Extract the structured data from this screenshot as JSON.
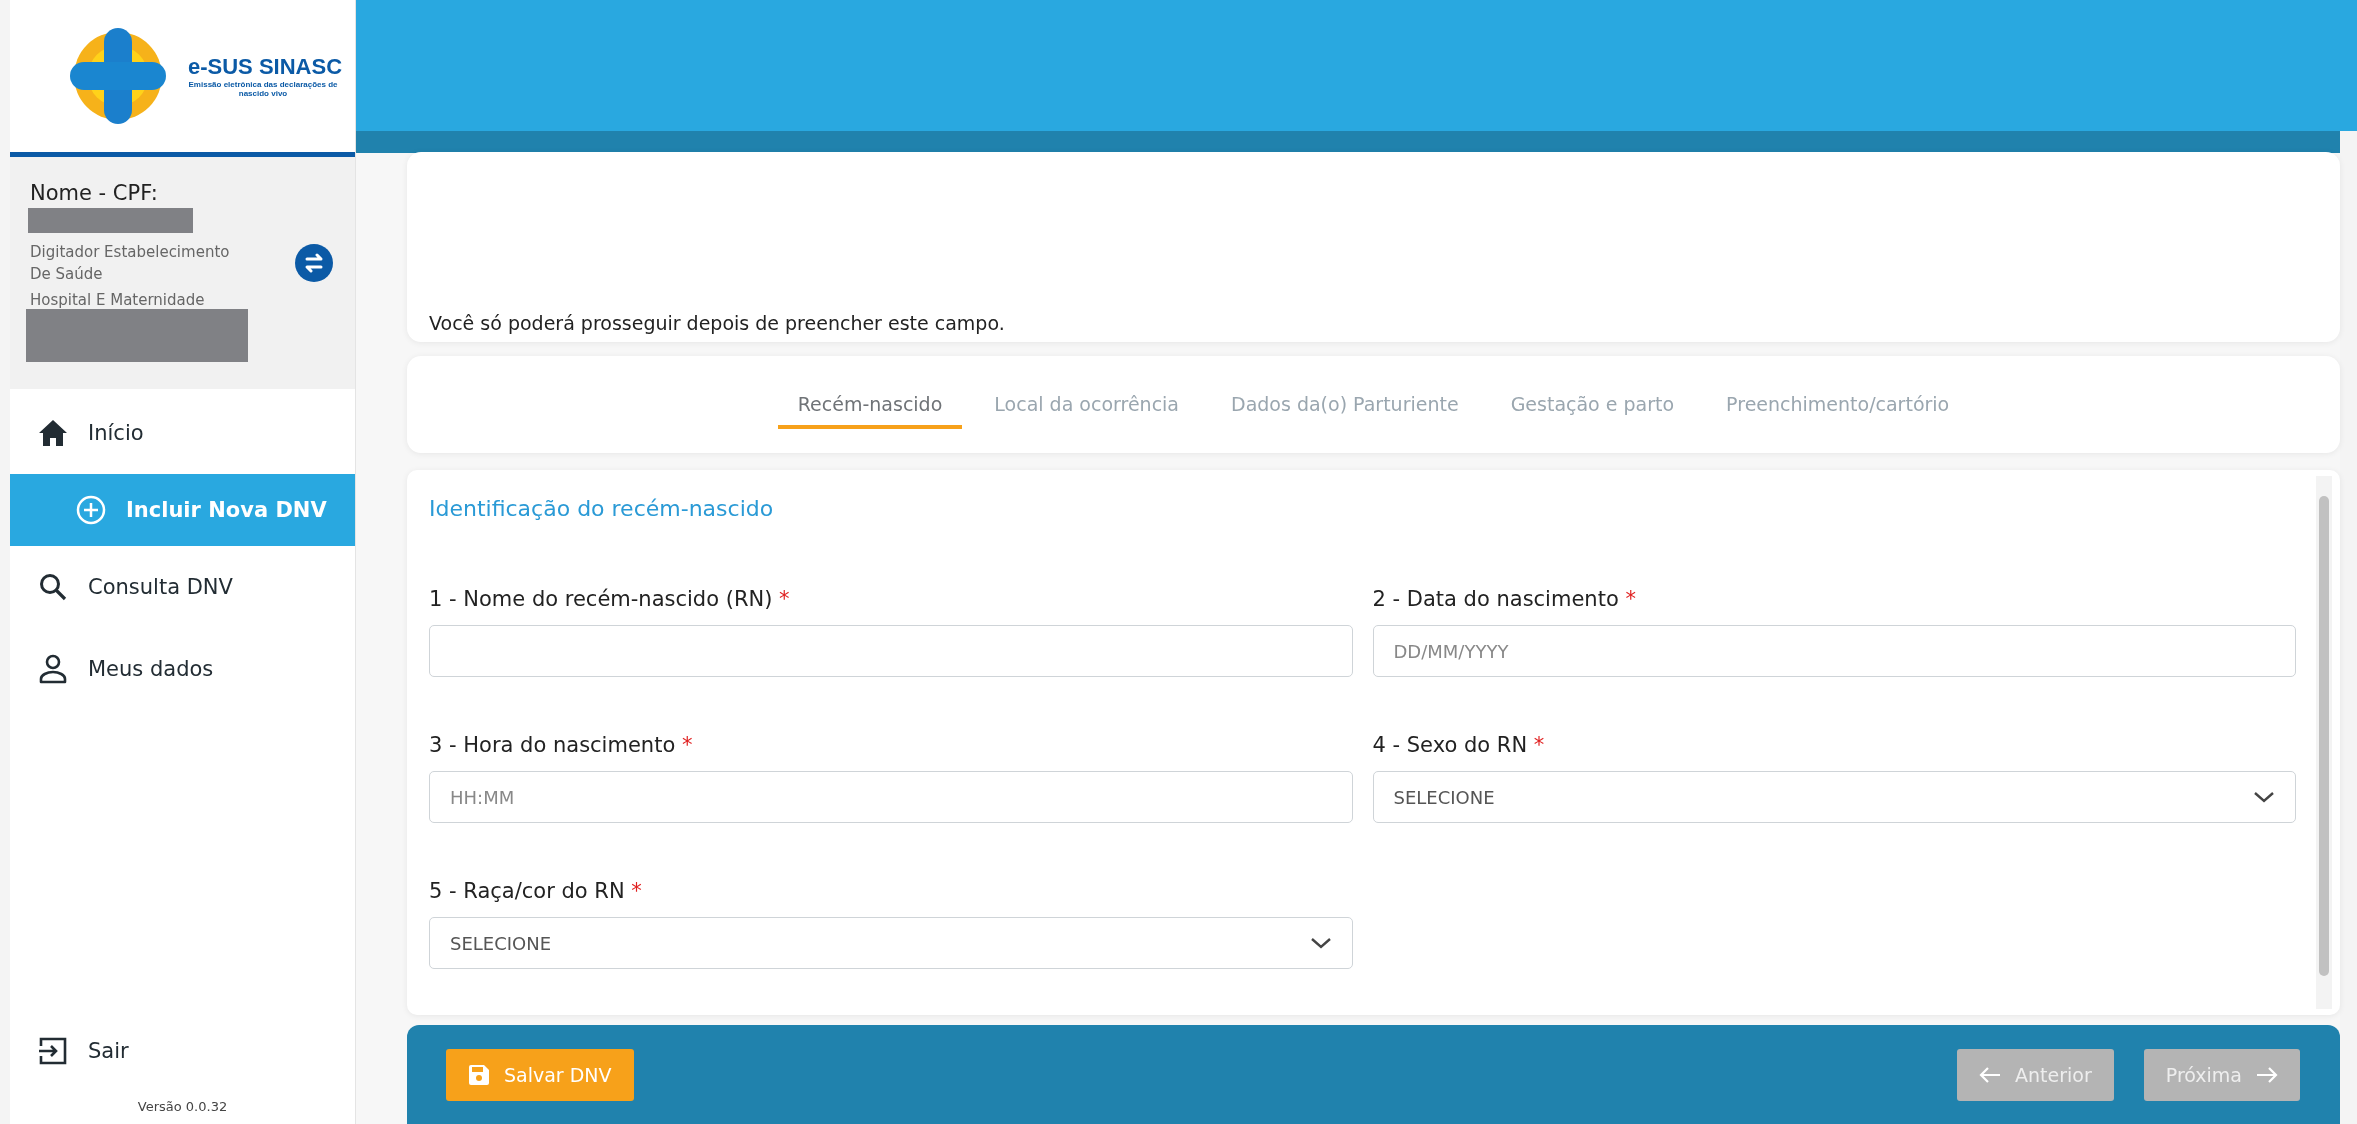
{
  "logo": {
    "title": "e-SUS SINASC",
    "subtitle": "Emissão eletrônica das declarações de nascido vivo"
  },
  "user": {
    "label": "Nome - CPF:",
    "role": "Digitador Estabelecimento De Saúde",
    "facility": "Hospital E Maternidade"
  },
  "nav": [
    {
      "label": "Início",
      "kind": "home",
      "selected": false
    },
    {
      "label": "Incluir Nova DNV",
      "kind": "add",
      "selected": true
    },
    {
      "label": "Consulta DNV",
      "kind": "search",
      "selected": false
    },
    {
      "label": "Meus dados",
      "kind": "profile",
      "selected": false
    }
  ],
  "logout": {
    "label": "Sair"
  },
  "version": "Versão 0.0.32",
  "notice": "Você só poderá prosseguir depois de preencher este campo.",
  "tabs": [
    {
      "label": "Recém-nascido",
      "selected": true
    },
    {
      "label": "Local da ocorrência",
      "selected": false
    },
    {
      "label": "Dados da(o) Parturiente",
      "selected": false
    },
    {
      "label": "Gestação e parto",
      "selected": false
    },
    {
      "label": "Preenchimento/cartório",
      "selected": false
    }
  ],
  "section_title": "Identificação do recém-nascido",
  "fields": [
    {
      "kind": "text",
      "label": "1 - Nome do recém-nascido (RN)",
      "mark": "*"
    },
    {
      "kind": "text",
      "label": "2 - Data do nascimento",
      "mark": "*",
      "placeholder": "DD/MM/YYYY"
    },
    {
      "kind": "text",
      "label": "3 - Hora do nascimento",
      "mark": "*",
      "placeholder": "HH:MM"
    },
    {
      "kind": "select",
      "label": "4 - Sexo do RN",
      "mark": "*",
      "value": "SELECIONE"
    },
    {
      "kind": "select",
      "label": "5 - Raça/cor do RN",
      "mark": "*",
      "value": "SELECIONE"
    }
  ],
  "footer": {
    "save": "Salvar DNV",
    "previous": {
      "label": "Anterior",
      "disabled": true
    },
    "next": {
      "label": "Próxima",
      "disabled": true
    }
  }
}
